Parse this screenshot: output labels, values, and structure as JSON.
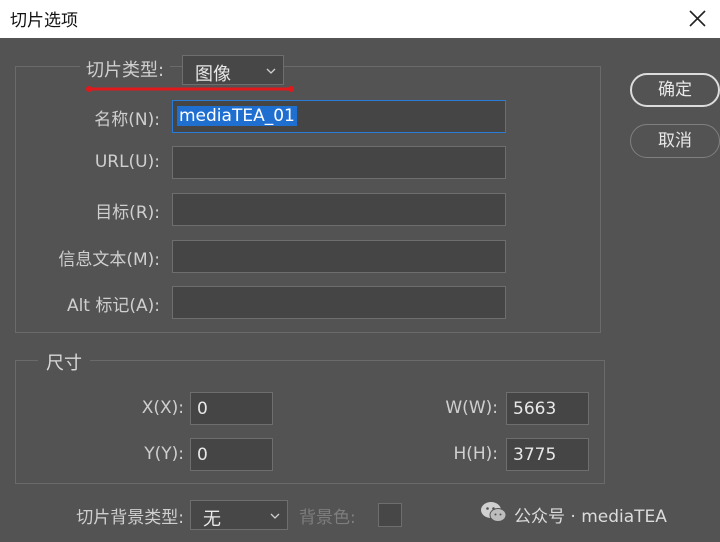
{
  "window": {
    "title": "切片选项"
  },
  "slice": {
    "type_label": "切片类型:",
    "type_value": "图像",
    "fields": [
      {
        "label": "名称(N):",
        "value": "mediaTEA_01"
      },
      {
        "label": "URL(U):",
        "value": ""
      },
      {
        "label": "目标(R):",
        "value": ""
      },
      {
        "label": "信息文本(M):",
        "value": ""
      },
      {
        "label": "Alt 标记(A):",
        "value": ""
      }
    ]
  },
  "buttons": {
    "ok": "确定",
    "cancel": "取消"
  },
  "size": {
    "title": "尺寸",
    "x_label": "X(X):",
    "x_value": "0",
    "y_label": "Y(Y):",
    "y_value": "0",
    "w_label": "W(W):",
    "w_value": "5663",
    "h_label": "H(H):",
    "h_value": "3775"
  },
  "background": {
    "type_label": "切片背景类型:",
    "type_value": "无",
    "color_label": "背景色:"
  },
  "watermark": {
    "text": "公众号 · mediaTEA"
  },
  "colors": {
    "dialog_bg": "#535353",
    "selection": "#1f6fd1",
    "annotation_red": "#e0191c"
  }
}
